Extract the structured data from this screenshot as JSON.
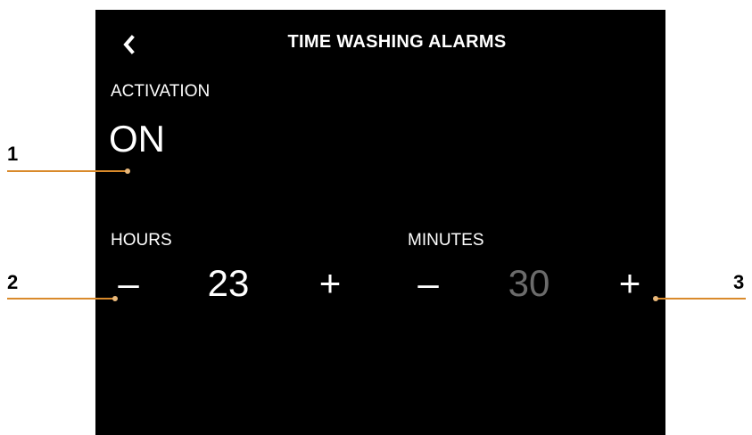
{
  "header": {
    "title": "TIME WASHING ALARMS",
    "back_icon": "chevron-left-icon"
  },
  "activation": {
    "label": "ACTIVATION",
    "value": "ON"
  },
  "hours": {
    "label": "HOURS",
    "minus": "–",
    "value": "23",
    "plus": "+"
  },
  "minutes": {
    "label": "MINUTES",
    "minus": "–",
    "value": "30",
    "plus": "+"
  },
  "callouts": {
    "one": "1",
    "two": "2",
    "three": "3"
  },
  "colors": {
    "screen_background": "#000000",
    "text": "#ffffff",
    "dimmed_value": "#6b6b6b",
    "callout_line": "#d98a2b"
  }
}
